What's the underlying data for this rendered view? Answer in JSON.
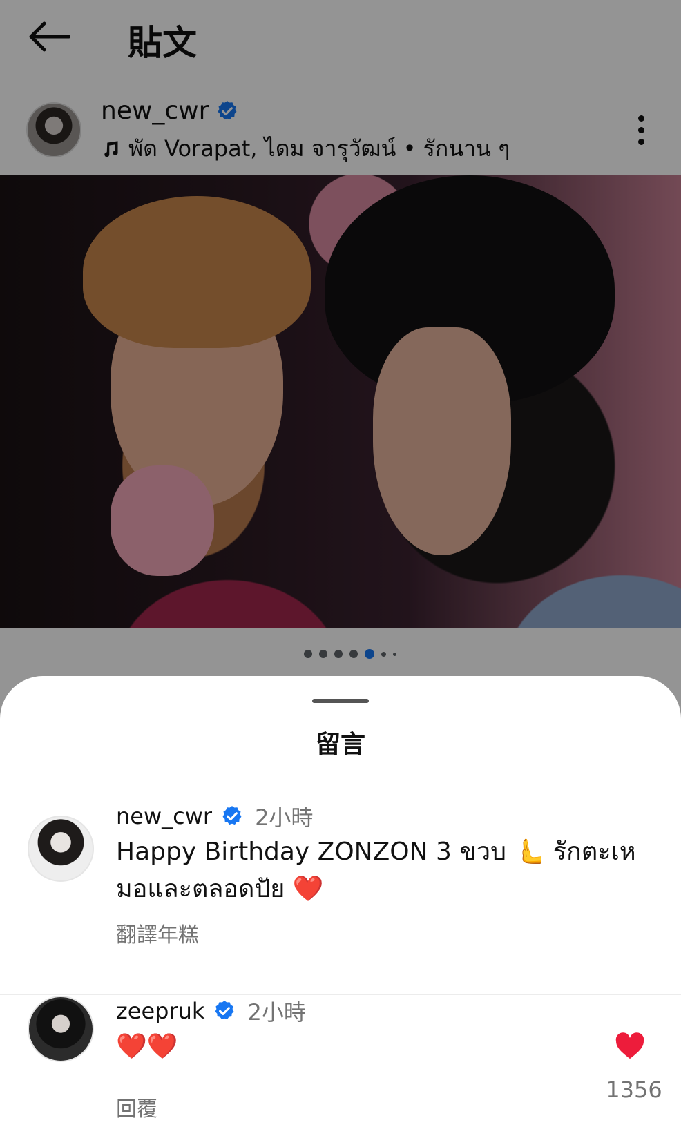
{
  "header": {
    "title": "貼文"
  },
  "post": {
    "username": "new_cwr",
    "music": "พัด Vorapat, ไดม จารุวัฒน์ • รักนาน ๆ",
    "carousel": {
      "count": 7,
      "active_index": 4
    }
  },
  "sheet": {
    "title": "留言"
  },
  "comments": [
    {
      "username": "new_cwr",
      "time": "2小時",
      "text": "Happy Birthday ZONZON 3 ขวบ 🫷 รักตะเหมอและตลอดปัย ❤️",
      "action": "翻譯年糕"
    },
    {
      "username": "zeepruk",
      "time": "2小時",
      "text": "❤️❤️",
      "action": "回覆",
      "likes": "1356"
    }
  ],
  "colors": {
    "verified": "#1877f2",
    "like": "#ed1c3b",
    "muted": "#737373"
  }
}
